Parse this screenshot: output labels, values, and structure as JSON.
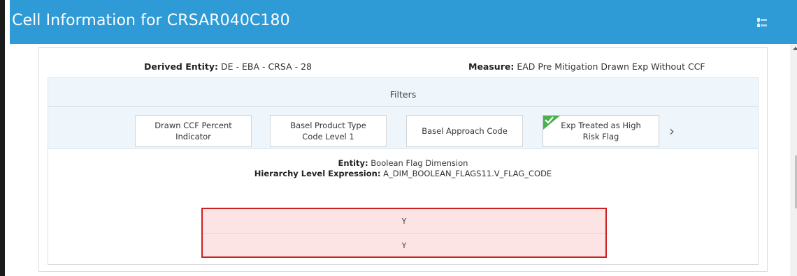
{
  "window": {
    "title": "Cell Information for CRSAR040C180",
    "collapse_icon": "collapse-panel-icon"
  },
  "info": {
    "derived_entity_label": "Derived Entity:",
    "derived_entity_value": "DE - EBA - CRSA - 28",
    "measure_label": "Measure:",
    "measure_value": "EAD Pre Mitigation Drawn Exp Without CCF"
  },
  "filters": {
    "title": "Filters",
    "items": [
      {
        "label": "Drawn CCF Percent Indicator",
        "selected": false
      },
      {
        "label": "Basel Product Type Code Level 1",
        "selected": false
      },
      {
        "label": "Basel Approach Code",
        "selected": false
      },
      {
        "label": "Exp Treated as High Risk Flag",
        "selected": true
      }
    ],
    "next_icon": "chevron-right-icon",
    "check_color": "#4caf50"
  },
  "details": {
    "entity_label": "Entity:",
    "entity_value": "Boolean Flag Dimension",
    "hierarchy_label": "Hierarchy Level Expression:",
    "hierarchy_value": "A_DIM_BOOLEAN_FLAGS11.V_FLAG_CODE",
    "values": [
      "Y",
      "Y"
    ],
    "highlight_color": "#cc2020"
  },
  "colors": {
    "titlebar": "#2e9ad6",
    "filters_bg": "#eef5fb"
  }
}
